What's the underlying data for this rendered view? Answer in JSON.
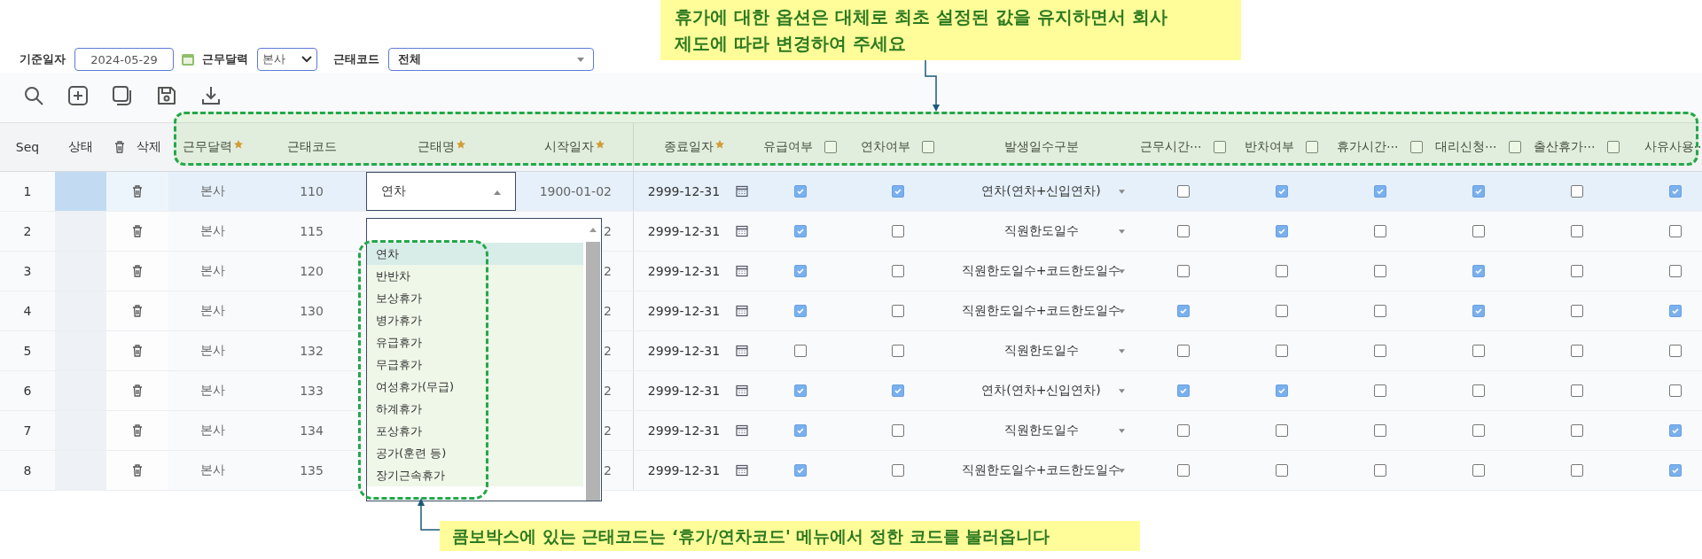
{
  "callouts": [
    {
      "kind": "top",
      "text": "휴가에 대한 옵션은 대체로 최초 설정된 값을 유지하면서 회사\n제도에 따라 변경하여 주세요"
    },
    {
      "kind": "bottom",
      "text": "콤보박스에 있는 근태코드는 ‘휴가/연차코드' 메뉴에서 정한 코드를 불러옵니다"
    }
  ],
  "filters": [
    {
      "label": "기준일자",
      "kind": "date",
      "value": "2024-05-29"
    },
    {
      "label": "근무달력",
      "kind": "select",
      "value": "본사"
    },
    {
      "label": "근태코드",
      "kind": "combo",
      "value": "전체"
    }
  ],
  "columns": [
    {
      "label": "Seq",
      "kind": "text",
      "required": false
    },
    {
      "label": "상태",
      "kind": "text",
      "required": false
    },
    {
      "label": "삭제",
      "kind": "delete",
      "required": false
    },
    {
      "label": "근무달력",
      "kind": "text",
      "required": true
    },
    {
      "label": "근태코드",
      "kind": "text",
      "required": false
    },
    {
      "label": "근태명",
      "kind": "text",
      "required": true
    },
    {
      "label": "시작일자",
      "kind": "text",
      "required": true
    },
    {
      "label": "종료일자",
      "kind": "text",
      "required": true
    },
    {
      "label": "유급여부",
      "kind": "check",
      "required": false,
      "checked": false
    },
    {
      "label": "연차여부",
      "kind": "check",
      "required": false,
      "checked": false
    },
    {
      "label": "발생일수구분",
      "kind": "text",
      "required": false
    },
    {
      "label": "근무시간⋯",
      "kind": "check",
      "required": false,
      "checked": false
    },
    {
      "label": "반차여부",
      "kind": "check",
      "required": false,
      "checked": false
    },
    {
      "label": "휴가시간⋯",
      "kind": "check",
      "required": false,
      "checked": false
    },
    {
      "label": "대리신청⋯",
      "kind": "check",
      "required": false,
      "checked": false
    },
    {
      "label": "출산휴가⋯",
      "kind": "check",
      "required": false,
      "checked": false
    },
    {
      "label": "사유사용⋯",
      "kind": "text",
      "required": false
    }
  ],
  "rows": [
    {
      "seq": "1",
      "selected": true,
      "office": "본사",
      "code": "110",
      "name": "연차",
      "start_date": "1900-01-02",
      "end_date": "2999-12-31",
      "accrual": "연차(연차+신입연차)",
      "checks": [
        true,
        true,
        false,
        true,
        true,
        true,
        false,
        true
      ]
    },
    {
      "seq": "2",
      "selected": false,
      "office": "본사",
      "code": "115",
      "start_date": "2",
      "end_date": "2999-12-31",
      "accrual": "직원한도일수",
      "checks": [
        true,
        false,
        false,
        true,
        false,
        false,
        false,
        false
      ]
    },
    {
      "seq": "3",
      "selected": false,
      "office": "본사",
      "code": "120",
      "start_date": "2",
      "end_date": "2999-12-31",
      "accrual": "직원한도일수+코드한도일수",
      "checks": [
        true,
        false,
        false,
        false,
        false,
        true,
        false,
        false
      ]
    },
    {
      "seq": "4",
      "selected": false,
      "office": "본사",
      "code": "130",
      "start_date": "2",
      "end_date": "2999-12-31",
      "accrual": "직원한도일수+코드한도일수",
      "checks": [
        true,
        false,
        true,
        false,
        false,
        true,
        false,
        true
      ]
    },
    {
      "seq": "5",
      "selected": false,
      "office": "본사",
      "code": "132",
      "start_date": "2",
      "end_date": "2999-12-31",
      "accrual": "직원한도일수",
      "checks": [
        false,
        false,
        false,
        false,
        false,
        false,
        false,
        false
      ]
    },
    {
      "seq": "6",
      "selected": false,
      "office": "본사",
      "code": "133",
      "start_date": "2",
      "end_date": "2999-12-31",
      "accrual": "연차(연차+신입연차)",
      "checks": [
        true,
        true,
        true,
        true,
        false,
        false,
        false,
        false
      ]
    },
    {
      "seq": "7",
      "selected": false,
      "office": "본사",
      "code": "134",
      "start_date": "2",
      "end_date": "2999-12-31",
      "accrual": "직원한도일수",
      "checks": [
        true,
        false,
        false,
        false,
        false,
        false,
        false,
        true
      ]
    },
    {
      "seq": "8",
      "selected": false,
      "office": "본사",
      "code": "135",
      "start_date": "2",
      "end_date": "2999-12-31",
      "accrual": "직원한도일수+코드한도일수",
      "checks": [
        true,
        false,
        false,
        false,
        false,
        false,
        false,
        true
      ]
    }
  ],
  "name_dropdown": {
    "expanded": true,
    "options": [
      {
        "label": "연차",
        "selected": true
      },
      {
        "label": "반반차",
        "selected": false
      },
      {
        "label": "보상휴가",
        "selected": false
      },
      {
        "label": "병가휴가",
        "selected": false
      },
      {
        "label": "유급휴가",
        "selected": false
      },
      {
        "label": "무급휴가",
        "selected": false
      },
      {
        "label": "여성휴가(무급)",
        "selected": false
      },
      {
        "label": "하계휴가",
        "selected": false
      },
      {
        "label": "포상휴가",
        "selected": false
      },
      {
        "label": "공가(훈련 등)",
        "selected": false
      },
      {
        "label": "장기근속휴가",
        "selected": false
      }
    ]
  }
}
